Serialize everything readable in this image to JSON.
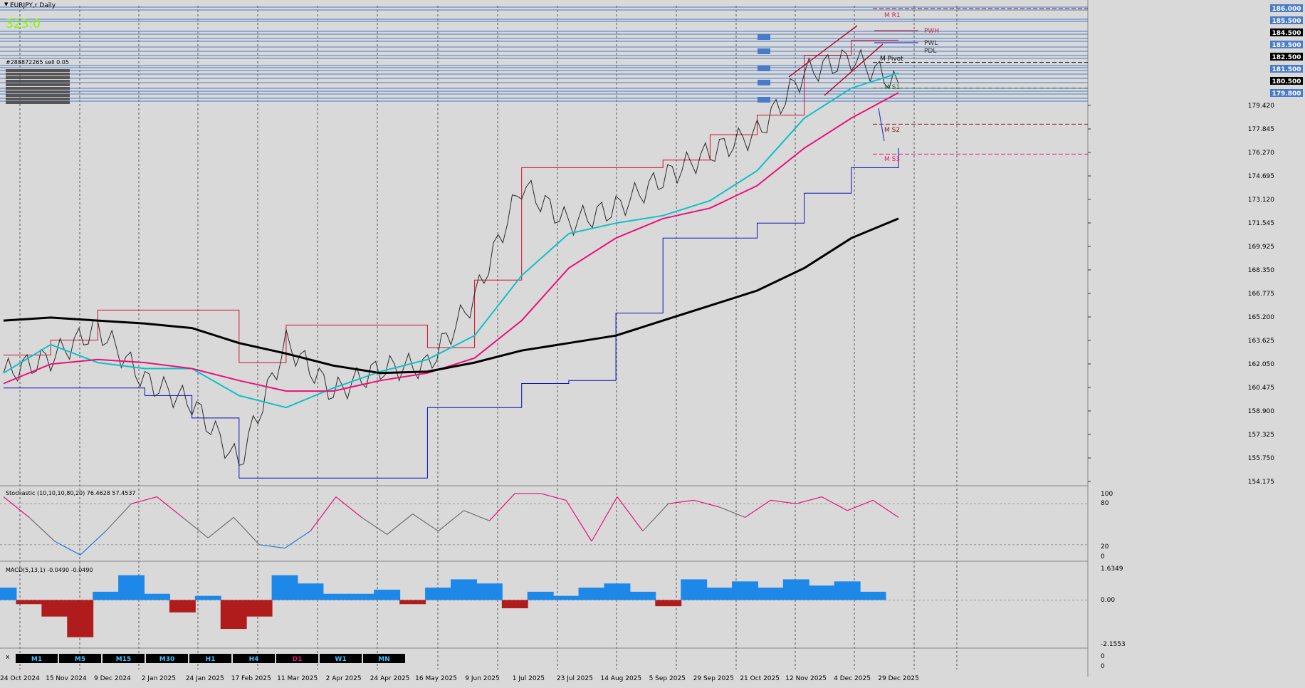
{
  "window": {
    "title": "EURJPY,r Daily"
  },
  "header": {
    "counter": "323:0"
  },
  "orders": {
    "first_label": "#288872265 sell 0.05",
    "stack_count": 11
  },
  "price_axis": {
    "ticks": [
      "179.420",
      "177.845",
      "176.270",
      "174.695",
      "173.120",
      "171.545",
      "169.925",
      "168.350",
      "166.775",
      "165.200",
      "163.625",
      "162.050",
      "160.475",
      "158.900",
      "157.325",
      "155.750",
      "154.175"
    ],
    "top_labels": [
      {
        "text": "186.000",
        "bg": "#4a7bc8"
      },
      {
        "text": "185.500",
        "bg": "#4a7bc8"
      },
      {
        "text": "184.500",
        "bg": "#000000"
      },
      {
        "text": "183.500",
        "bg": "#4a7bc8"
      },
      {
        "text": "182.500",
        "bg": "#000000"
      },
      {
        "text": "181.500",
        "bg": "#4a7bc8"
      },
      {
        "text": "180.500",
        "bg": "#000000"
      },
      {
        "text": "179.800",
        "bg": "#4a7bc8"
      }
    ]
  },
  "levels": {
    "m_r1": "M R1",
    "pwh": "PWH",
    "pwl": "PWL",
    "pdl": "PDL",
    "m_pivot": "M Pivot",
    "m_s1": "M S1",
    "m_s2": "M S2",
    "m_s3": "M S3"
  },
  "stochastic": {
    "label": "Stochastic (10,10,10,80,20) 76.4628 57.4537",
    "axis": [
      "100",
      "80",
      "20",
      "0"
    ]
  },
  "macd": {
    "label": "MACD(5,13,1) -0.0490 -0.0490",
    "axis": [
      "1.6349",
      "0.00",
      "-2.1553"
    ]
  },
  "bottom_axis": [
    "0",
    "0"
  ],
  "timeframes": [
    {
      "label": "M1",
      "active": false
    },
    {
      "label": "M5",
      "active": false
    },
    {
      "label": "M15",
      "active": false
    },
    {
      "label": "M30",
      "active": false
    },
    {
      "label": "H1",
      "active": false
    },
    {
      "label": "H4",
      "active": false
    },
    {
      "label": "D1",
      "active": true
    },
    {
      "label": "W1",
      "active": false
    },
    {
      "label": "MN",
      "active": false
    }
  ],
  "close_label": "x",
  "dates": [
    "24 Oct 2024",
    "15 Nov 2024",
    "9 Dec 2024",
    "2 Jan 2025",
    "24 Jan 2025",
    "17 Feb 2025",
    "11 Mar 2025",
    "2 Apr 2025",
    "24 Apr 2025",
    "16 May 2025",
    "9 Jun 2025",
    "1 Jul 2025",
    "23 Jul 2025",
    "14 Aug 2025",
    "5 Sep 2025",
    "29 Sep 2025",
    "21 Oct 2025",
    "12 Nov 2025",
    "4 Dec 2025",
    "29 Dec 2025"
  ],
  "colors": {
    "bg": "#d9d9d9",
    "grid": "#555555",
    "price": "#2a2a2a",
    "ma_fast": "#10c0c8",
    "ma_mid": "#e8127a",
    "ma_slow": "#000000",
    "donchian_high": "#d01030",
    "donchian_low": "#0a10b8",
    "stoch": "#707070",
    "stoch_hot": "#e8127a",
    "stoch_cold": "#1e7ad8",
    "macd_pos": "#1e88e8",
    "macd_neg": "#b01c1c"
  },
  "chart_data": {
    "type": "line",
    "symbol": "EURJPY,r",
    "timeframe": "Daily",
    "x": [
      "24 Oct 2024",
      "15 Nov 2024",
      "9 Dec 2024",
      "2 Jan 2025",
      "24 Jan 2025",
      "17 Feb 2025",
      "11 Mar 2025",
      "2 Apr 2025",
      "24 Apr 2025",
      "16 May 2025",
      "9 Jun 2025",
      "1 Jul 2025",
      "23 Jul 2025",
      "14 Aug 2025",
      "5 Sep 2025",
      "29 Sep 2025",
      "21 Oct 2025",
      "12 Nov 2025",
      "4 Dec 2025",
      "29 Dec 2025"
    ],
    "series": [
      {
        "values": [
          161.5,
          162.5,
          164.5,
          161,
          159.5,
          155.5,
          163.5,
          160.2,
          161.8,
          162,
          166.5,
          174,
          171.5,
          172.5,
          174.5,
          176.2,
          177.5,
          181.5,
          182.5,
          180.8
        ]
      },
      {
        "values": [
          161.5,
          163.4,
          162.2,
          161.8,
          161.8,
          160,
          159.2,
          160.5,
          161.6,
          162.4,
          164,
          168,
          170.8,
          171.5,
          172,
          173,
          175,
          178.5,
          180.5,
          181.5
        ]
      },
      {
        "values": [
          160.8,
          162.1,
          162.4,
          162.2,
          161.8,
          161,
          160.3,
          160.3,
          161,
          161.5,
          162.5,
          165,
          168.5,
          170.5,
          171.8,
          172.5,
          174,
          176.5,
          178.5,
          180.2
        ]
      },
      {
        "values": [
          165,
          165.2,
          165,
          164.8,
          164.5,
          163.5,
          162.8,
          162,
          161.5,
          161.6,
          162.2,
          163,
          163.5,
          164,
          165,
          166,
          167,
          168.5,
          170.5,
          171.8
        ]
      }
    ],
    "ylim": [
      154.175,
      186.0
    ],
    "levels": {
      "m_r1": 186.0,
      "pwh": 184.5,
      "pwl": 183.5,
      "m_pivot": 182.5,
      "m_s1": 180.5,
      "m_s2": 178.0,
      "m_s3": 176.2
    },
    "stochastic": {
      "params": "10,10,10,80,20",
      "main": 76.4628,
      "signal": 57.4537,
      "ylim": [
        0,
        100
      ],
      "values": [
        90,
        60,
        25,
        5,
        40,
        80,
        90,
        60,
        30,
        60,
        20,
        15,
        40,
        90,
        60,
        35,
        65,
        40,
        70,
        55,
        95,
        95,
        85,
        25,
        90,
        40,
        80,
        85,
        75,
        60,
        85,
        80,
        90,
        70,
        85,
        60
      ]
    },
    "macd": {
      "params": "5,13,1",
      "main": -0.049,
      "signal": -0.049,
      "ylim": [
        -2.1553,
        1.6349
      ],
      "values": [
        0.6,
        -0.2,
        -0.8,
        -1.8,
        0.4,
        1.2,
        0.3,
        -0.6,
        0.2,
        -1.4,
        -0.8,
        1.2,
        0.8,
        0.3,
        0.3,
        0.5,
        -0.2,
        0.6,
        1.0,
        0.8,
        -0.4,
        0.4,
        0.2,
        0.6,
        0.8,
        0.4,
        -0.3,
        1.0,
        0.6,
        0.9,
        0.6,
        1.0,
        0.7,
        0.9,
        0.4,
        0.0
      ]
    }
  }
}
